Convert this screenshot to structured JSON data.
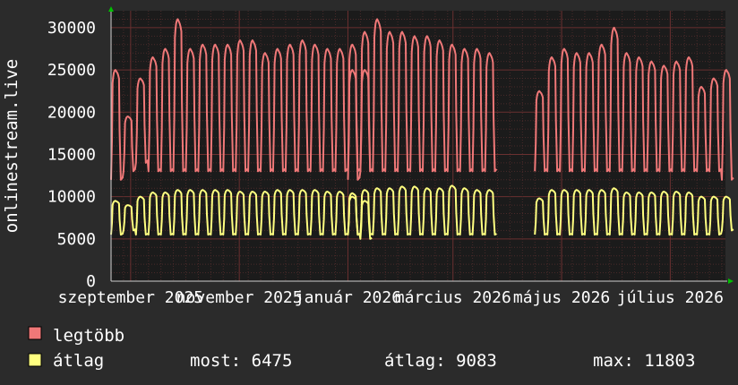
{
  "chart_data": {
    "type": "line",
    "ylabel": "onlinestream.live",
    "ylim": [
      0,
      32000
    ],
    "yticks": [
      0,
      5000,
      10000,
      15000,
      20000,
      25000,
      30000
    ],
    "ytick_labels": [
      "0",
      "5000",
      "10000",
      "15000",
      "20000",
      "25000",
      "30000"
    ],
    "xlim": [
      "2025-08-21",
      "2026-08-01"
    ],
    "xticks": [
      {
        "date": "2025-09-01",
        "label": "szeptember 2025"
      },
      {
        "date": "2025-11-01",
        "label": "november 2025"
      },
      {
        "date": "2026-01-01",
        "label": "január 2026"
      },
      {
        "date": "2026-03-01",
        "label": "március 2026"
      },
      {
        "date": "2026-05-01",
        "label": "május 2026"
      },
      {
        "date": "2026-07-01",
        "label": "július 2026"
      }
    ],
    "grid": true,
    "series": [
      {
        "name": "legtöbb",
        "color": "#f07878",
        "segments": [
          {
            "start": "2025-08-21",
            "weeks": [
              [
                12000,
                25000
              ],
              [
                13000,
                19500
              ],
              [
                14000,
                24000
              ],
              [
                13000,
                26500
              ],
              [
                13000,
                27500
              ],
              [
                13000,
                31000
              ],
              [
                13000,
                27500
              ],
              [
                13000,
                28000
              ],
              [
                13000,
                28000
              ],
              [
                13000,
                28000
              ],
              [
                13000,
                28500
              ],
              [
                13000,
                28500
              ],
              [
                13000,
                27000
              ],
              [
                13000,
                27500
              ],
              [
                13000,
                28000
              ],
              [
                13000,
                28500
              ],
              [
                13000,
                28000
              ],
              [
                13000,
                27500
              ],
              [
                13000,
                27500
              ],
              [
                13000,
                28000
              ],
              [
                13000,
                25000
              ]
            ]
          },
          {
            "start": "2026-01-01",
            "weeks": [
              [
                12000,
                25000
              ],
              [
                13000,
                29500
              ],
              [
                13000,
                31000
              ],
              [
                13000,
                29500
              ],
              [
                13000,
                29500
              ],
              [
                13000,
                29000
              ],
              [
                13000,
                29000
              ],
              [
                13000,
                28500
              ],
              [
                13000,
                28000
              ],
              [
                13000,
                27500
              ],
              [
                13000,
                27500
              ],
              [
                13000,
                27000
              ]
            ]
          },
          {
            "start": "2026-04-16",
            "weeks": [
              [
                13000,
                22500
              ],
              [
                13000,
                26500
              ],
              [
                13000,
                27500
              ],
              [
                13000,
                27000
              ],
              [
                13000,
                27000
              ],
              [
                13000,
                28000
              ],
              [
                13000,
                30000
              ],
              [
                13000,
                27000
              ],
              [
                13000,
                26500
              ],
              [
                13000,
                26000
              ],
              [
                13000,
                25500
              ],
              [
                13000,
                26000
              ],
              [
                13000,
                26500
              ],
              [
                13000,
                23000
              ],
              [
                13000,
                24000
              ],
              [
                12000,
                25000
              ]
            ]
          }
        ]
      },
      {
        "name": "átlag",
        "color": "#ffff80",
        "segments": [
          {
            "start": "2025-08-21",
            "weeks": [
              [
                5500,
                9500
              ],
              [
                6000,
                9000
              ],
              [
                5500,
                10000
              ],
              [
                5500,
                10500
              ],
              [
                5500,
                10500
              ],
              [
                5500,
                10800
              ],
              [
                5500,
                10800
              ],
              [
                5500,
                10800
              ],
              [
                5500,
                10800
              ],
              [
                5500,
                10800
              ],
              [
                5500,
                10600
              ],
              [
                5500,
                10600
              ],
              [
                5500,
                10600
              ],
              [
                5500,
                10800
              ],
              [
                5500,
                10800
              ],
              [
                5500,
                10800
              ],
              [
                5500,
                10800
              ],
              [
                5500,
                10600
              ],
              [
                5500,
                10600
              ],
              [
                5500,
                10400
              ],
              [
                5000,
                9500
              ]
            ]
          },
          {
            "start": "2026-01-01",
            "weeks": [
              [
                5500,
                10000
              ],
              [
                5500,
                10800
              ],
              [
                5500,
                11000
              ],
              [
                5500,
                11000
              ],
              [
                5500,
                11200
              ],
              [
                5500,
                11200
              ],
              [
                5500,
                11000
              ],
              [
                5500,
                11000
              ],
              [
                5500,
                11300
              ],
              [
                5500,
                11000
              ],
              [
                5500,
                10800
              ],
              [
                5500,
                10800
              ]
            ]
          },
          {
            "start": "2026-04-16",
            "weeks": [
              [
                5500,
                9800
              ],
              [
                5500,
                10800
              ],
              [
                5500,
                10800
              ],
              [
                5500,
                10800
              ],
              [
                5500,
                10800
              ],
              [
                5500,
                10800
              ],
              [
                5500,
                11000
              ],
              [
                5500,
                10500
              ],
              [
                5500,
                10500
              ],
              [
                5500,
                10500
              ],
              [
                5500,
                10600
              ],
              [
                5500,
                10600
              ],
              [
                5500,
                10500
              ],
              [
                5500,
                10000
              ],
              [
                5500,
                10000
              ],
              [
                6000,
                10000
              ]
            ]
          }
        ]
      }
    ],
    "legend": {
      "position": "bottom",
      "items": [
        {
          "label": "legtöbb",
          "color": "#f07878"
        },
        {
          "label": "átlag",
          "color": "#ffff80"
        }
      ],
      "stats": {
        "most": "most: 6475",
        "atlag": "átlag: 9083",
        "max": "max: 11803"
      }
    }
  },
  "colors": {
    "background": "#2b2b2b",
    "plot_background": "#1b1b1b",
    "grid": "#5a2e2e",
    "axis": "#d0d0d0",
    "arrow": "#00c000"
  }
}
